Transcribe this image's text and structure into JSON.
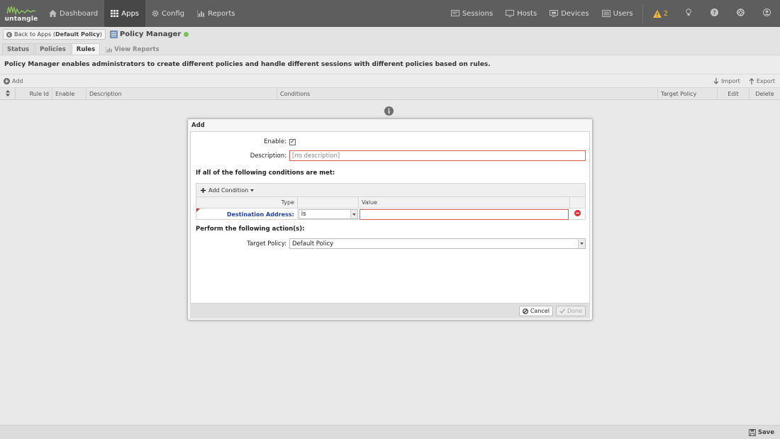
{
  "topbar": {
    "logo_text": "untangle",
    "nav": [
      {
        "label": "Dashboard",
        "icon": "home-icon"
      },
      {
        "label": "Apps",
        "icon": "apps-grid-icon"
      },
      {
        "label": "Config",
        "icon": "gear-icon"
      },
      {
        "label": "Reports",
        "icon": "chart-icon"
      }
    ],
    "right_nav": [
      {
        "label": "Sessions",
        "icon": "sessions-icon"
      },
      {
        "label": "Hosts",
        "icon": "hosts-icon"
      },
      {
        "label": "Devices",
        "icon": "devices-icon"
      },
      {
        "label": "Users",
        "icon": "users-icon"
      }
    ],
    "alert_count": "2",
    "colors": {
      "bar": "#5e5e5e",
      "active": "#474747",
      "alert": "#f0b840"
    }
  },
  "breadcrumb": {
    "back_prefix": "Back to Apps (",
    "back_policy": "Default Policy",
    "back_suffix": ")",
    "app_title": "Policy Manager",
    "status_color": "#7cc15a"
  },
  "tabs": [
    {
      "label": "Status"
    },
    {
      "label": "Policies"
    },
    {
      "label": "Rules"
    },
    {
      "label": "View Reports"
    }
  ],
  "description": "Policy Manager enables administrators to create different policies and handle different sessions with different policies based on rules.",
  "toolbar": {
    "add": "Add",
    "import": "Import",
    "export": "Export"
  },
  "grid": {
    "columns": [
      "Rule Id",
      "Enable",
      "Description",
      "Conditions",
      "Target Policy",
      "Edit",
      "Delete"
    ]
  },
  "dialog": {
    "title": "Add",
    "enable_label": "Enable:",
    "enable_checked": "✓",
    "description_label": "Description:",
    "description_value": "[no description]",
    "conditions_heading": "If all of the following conditions are met:",
    "add_condition": "Add Condition",
    "cond_columns": {
      "type": "Type",
      "value": "Value"
    },
    "condition": {
      "type": "Destination Address:",
      "operator": "is",
      "value": ""
    },
    "actions_heading": "Perform the following action(s):",
    "target_policy_label": "Target Policy:",
    "target_policy_value": "Default Policy",
    "cancel": "Cancel",
    "done": "Done"
  },
  "footer": {
    "save": "Save"
  }
}
